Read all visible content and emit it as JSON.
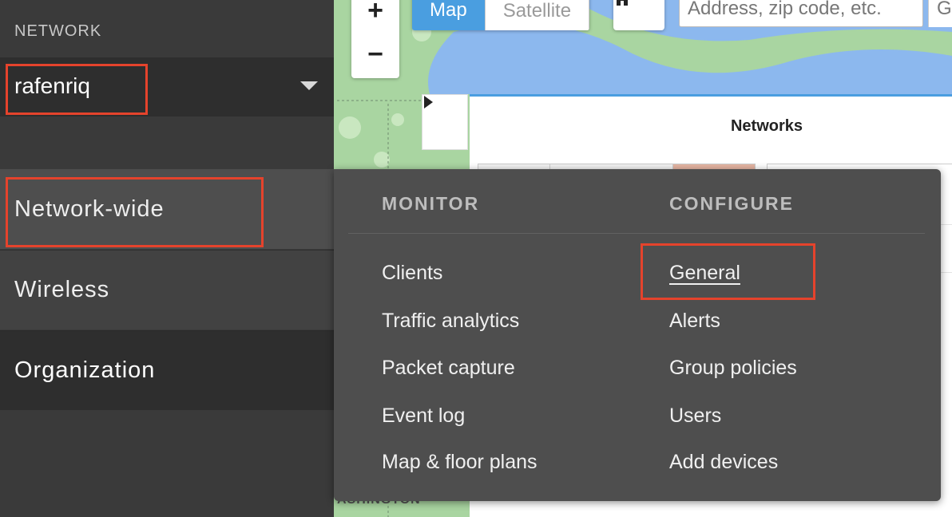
{
  "map": {
    "zoom_in": "+",
    "zoom_out": "−",
    "type_map": "Map",
    "type_satellite": "Satellite",
    "search_placeholder": "Address, zip code, etc.",
    "search_extra": "G",
    "place_label": "ASHINGTON",
    "panel_toggle_icon": "play-triangle-icon",
    "home_icon": "home-icon",
    "active_color": "#4a9ee0"
  },
  "networks_panel": {
    "title": "Networks"
  },
  "sidebar": {
    "network_heading": "NETWORK",
    "network_name": "rafenriq",
    "nav": {
      "network_wide": "Network-wide",
      "wireless": "Wireless",
      "organization": "Organization"
    }
  },
  "flyout": {
    "monitor_heading": "MONITOR",
    "configure_heading": "CONFIGURE",
    "monitor_items": [
      "Clients",
      "Traffic analytics",
      "Packet capture",
      "Event log",
      "Map & floor plans"
    ],
    "configure_items": [
      "General",
      "Alerts",
      "Group policies",
      "Users",
      "Add devices"
    ]
  },
  "highlight_color": "#e5432c"
}
